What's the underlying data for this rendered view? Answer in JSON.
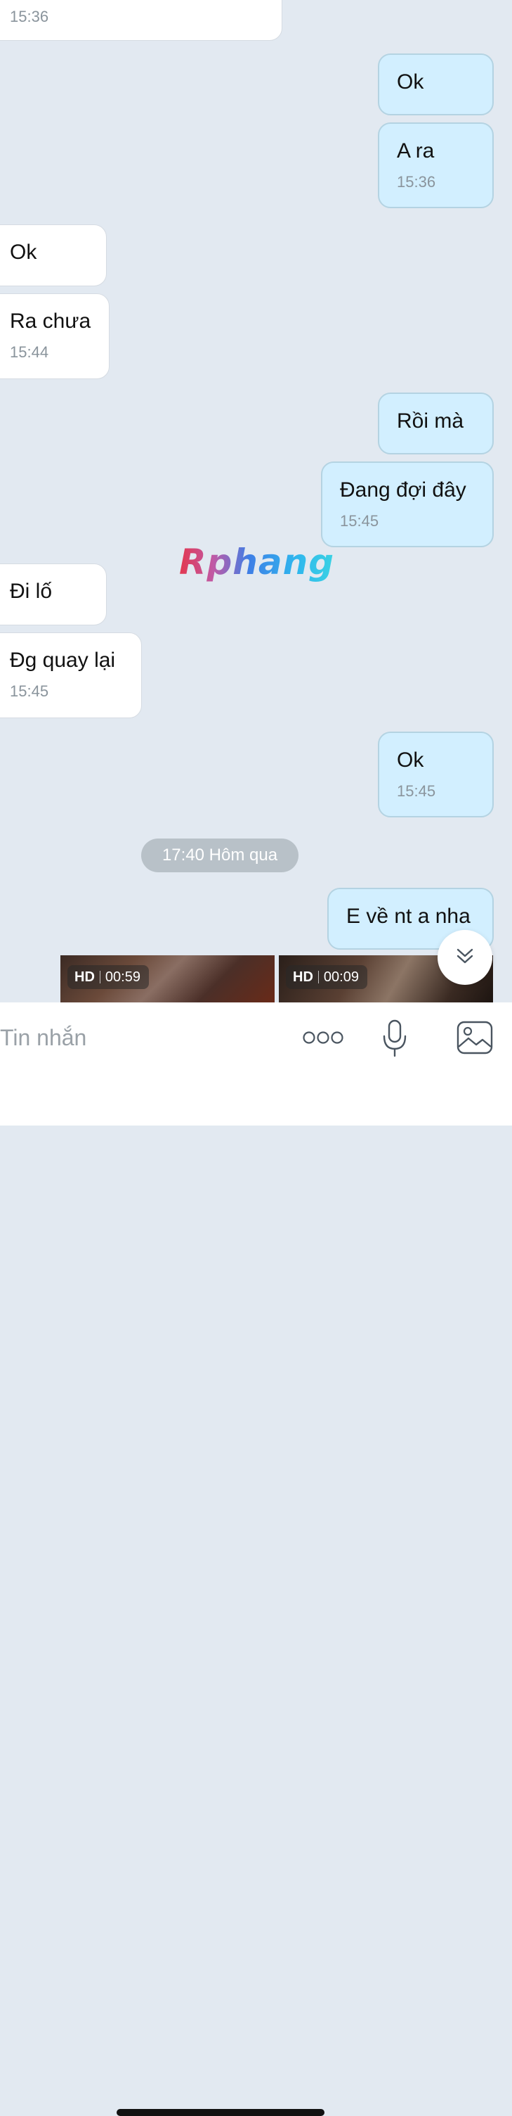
{
  "messages": [
    {
      "side": "recv",
      "text": "",
      "time": "15:36"
    },
    {
      "side": "sent",
      "text": "Ok",
      "time": ""
    },
    {
      "side": "sent",
      "text": "A ra",
      "time": "15:36"
    },
    {
      "side": "recv",
      "text": "Ok",
      "time": ""
    },
    {
      "side": "recv",
      "text": "Ra chưa",
      "time": "15:44"
    },
    {
      "side": "sent",
      "text": "Rồi mà",
      "time": ""
    },
    {
      "side": "sent",
      "text": "Đang đợi đây",
      "time": "15:45"
    },
    {
      "side": "recv",
      "text": "Đi lố",
      "time": ""
    },
    {
      "side": "recv",
      "text": "Đg quay lại",
      "time": "15:45"
    },
    {
      "side": "sent",
      "text": "Ok",
      "time": "15:45"
    },
    {
      "side": "sent",
      "text": "E về nt a nha",
      "time": ""
    }
  ],
  "date_separator": "17:40 Hôm qua",
  "watermark": "Rphang",
  "videos": [
    {
      "quality": "HD",
      "duration": "00:59"
    },
    {
      "quality": "HD",
      "duration": "00:09"
    }
  ],
  "composer": {
    "placeholder": "Tin nhắn"
  },
  "icons": {
    "scroll_down": "double-chevron-down-icon",
    "more": "more-dots-icon",
    "mic": "microphone-icon",
    "gallery": "image-gallery-icon"
  },
  "colors": {
    "background": "#e2e9f1",
    "sent_bubble": "#d2efff",
    "received_bubble": "#ffffff",
    "timestamp": "#8a949c"
  }
}
